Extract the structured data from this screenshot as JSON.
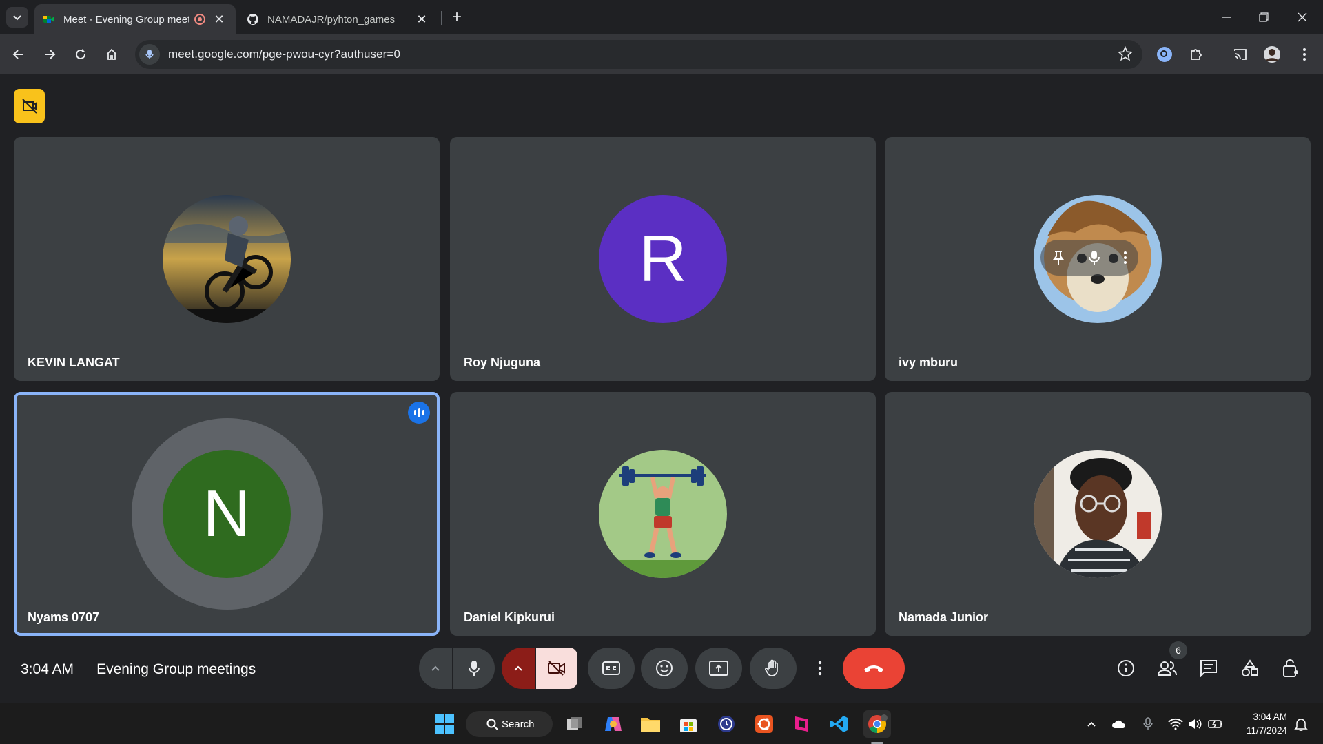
{
  "browser": {
    "tabs": [
      {
        "title": "Meet - Evening Group meet",
        "active": true
      },
      {
        "title": "NAMADAJR/pyhton_games",
        "active": false
      }
    ],
    "url": "meet.google.com/pge-pwou-cyr?authuser=0"
  },
  "meet": {
    "participants": [
      {
        "name": "KEVIN LANGAT",
        "avatar": "photo-cyclist"
      },
      {
        "name": "Roy Njuguna",
        "initial": "R",
        "color": "#5b2fc3"
      },
      {
        "name": "ivy mburu",
        "avatar": "photo-dog"
      },
      {
        "name": "Nyams 0707",
        "initial": "N",
        "color": "#2f6b1f",
        "speaking": true
      },
      {
        "name": "Daniel Kipkurui",
        "avatar": "illustration-weightlifter"
      },
      {
        "name": "Namada Junior",
        "avatar": "photo-man-glasses"
      }
    ],
    "time": "3:04 AM",
    "meeting_title": "Evening Group meetings",
    "people_count": "6",
    "colors": {
      "accent": "#8ab4f8",
      "end_call": "#ea4335",
      "recording": "#f9c21b",
      "cam_off": "#8c1d18"
    }
  },
  "taskbar": {
    "search_label": "Search",
    "time": "3:04 AM",
    "date": "11/7/2024"
  }
}
